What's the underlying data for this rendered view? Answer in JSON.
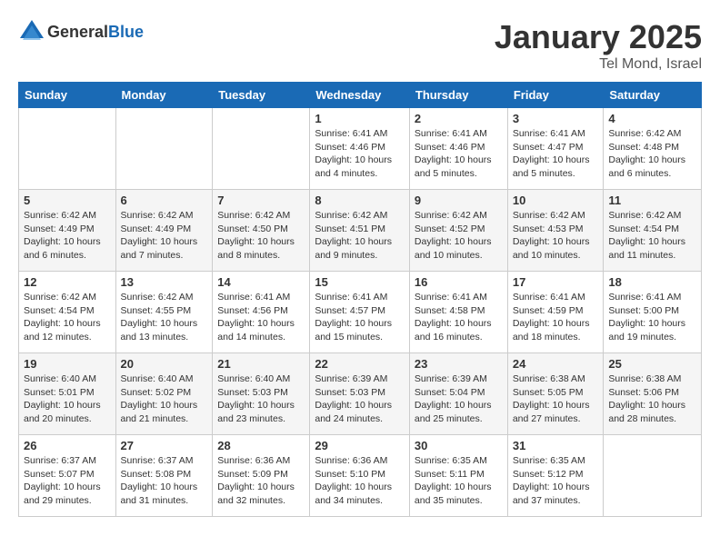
{
  "header": {
    "logo_general": "General",
    "logo_blue": "Blue",
    "month": "January 2025",
    "location": "Tel Mond, Israel"
  },
  "weekdays": [
    "Sunday",
    "Monday",
    "Tuesday",
    "Wednesday",
    "Thursday",
    "Friday",
    "Saturday"
  ],
  "weeks": [
    [
      {
        "day": "",
        "info": ""
      },
      {
        "day": "",
        "info": ""
      },
      {
        "day": "",
        "info": ""
      },
      {
        "day": "1",
        "info": "Sunrise: 6:41 AM\nSunset: 4:46 PM\nDaylight: 10 hours\nand 4 minutes."
      },
      {
        "day": "2",
        "info": "Sunrise: 6:41 AM\nSunset: 4:46 PM\nDaylight: 10 hours\nand 5 minutes."
      },
      {
        "day": "3",
        "info": "Sunrise: 6:41 AM\nSunset: 4:47 PM\nDaylight: 10 hours\nand 5 minutes."
      },
      {
        "day": "4",
        "info": "Sunrise: 6:42 AM\nSunset: 4:48 PM\nDaylight: 10 hours\nand 6 minutes."
      }
    ],
    [
      {
        "day": "5",
        "info": "Sunrise: 6:42 AM\nSunset: 4:49 PM\nDaylight: 10 hours\nand 6 minutes."
      },
      {
        "day": "6",
        "info": "Sunrise: 6:42 AM\nSunset: 4:49 PM\nDaylight: 10 hours\nand 7 minutes."
      },
      {
        "day": "7",
        "info": "Sunrise: 6:42 AM\nSunset: 4:50 PM\nDaylight: 10 hours\nand 8 minutes."
      },
      {
        "day": "8",
        "info": "Sunrise: 6:42 AM\nSunset: 4:51 PM\nDaylight: 10 hours\nand 9 minutes."
      },
      {
        "day": "9",
        "info": "Sunrise: 6:42 AM\nSunset: 4:52 PM\nDaylight: 10 hours\nand 10 minutes."
      },
      {
        "day": "10",
        "info": "Sunrise: 6:42 AM\nSunset: 4:53 PM\nDaylight: 10 hours\nand 10 minutes."
      },
      {
        "day": "11",
        "info": "Sunrise: 6:42 AM\nSunset: 4:54 PM\nDaylight: 10 hours\nand 11 minutes."
      }
    ],
    [
      {
        "day": "12",
        "info": "Sunrise: 6:42 AM\nSunset: 4:54 PM\nDaylight: 10 hours\nand 12 minutes."
      },
      {
        "day": "13",
        "info": "Sunrise: 6:42 AM\nSunset: 4:55 PM\nDaylight: 10 hours\nand 13 minutes."
      },
      {
        "day": "14",
        "info": "Sunrise: 6:41 AM\nSunset: 4:56 PM\nDaylight: 10 hours\nand 14 minutes."
      },
      {
        "day": "15",
        "info": "Sunrise: 6:41 AM\nSunset: 4:57 PM\nDaylight: 10 hours\nand 15 minutes."
      },
      {
        "day": "16",
        "info": "Sunrise: 6:41 AM\nSunset: 4:58 PM\nDaylight: 10 hours\nand 16 minutes."
      },
      {
        "day": "17",
        "info": "Sunrise: 6:41 AM\nSunset: 4:59 PM\nDaylight: 10 hours\nand 18 minutes."
      },
      {
        "day": "18",
        "info": "Sunrise: 6:41 AM\nSunset: 5:00 PM\nDaylight: 10 hours\nand 19 minutes."
      }
    ],
    [
      {
        "day": "19",
        "info": "Sunrise: 6:40 AM\nSunset: 5:01 PM\nDaylight: 10 hours\nand 20 minutes."
      },
      {
        "day": "20",
        "info": "Sunrise: 6:40 AM\nSunset: 5:02 PM\nDaylight: 10 hours\nand 21 minutes."
      },
      {
        "day": "21",
        "info": "Sunrise: 6:40 AM\nSunset: 5:03 PM\nDaylight: 10 hours\nand 23 minutes."
      },
      {
        "day": "22",
        "info": "Sunrise: 6:39 AM\nSunset: 5:03 PM\nDaylight: 10 hours\nand 24 minutes."
      },
      {
        "day": "23",
        "info": "Sunrise: 6:39 AM\nSunset: 5:04 PM\nDaylight: 10 hours\nand 25 minutes."
      },
      {
        "day": "24",
        "info": "Sunrise: 6:38 AM\nSunset: 5:05 PM\nDaylight: 10 hours\nand 27 minutes."
      },
      {
        "day": "25",
        "info": "Sunrise: 6:38 AM\nSunset: 5:06 PM\nDaylight: 10 hours\nand 28 minutes."
      }
    ],
    [
      {
        "day": "26",
        "info": "Sunrise: 6:37 AM\nSunset: 5:07 PM\nDaylight: 10 hours\nand 29 minutes."
      },
      {
        "day": "27",
        "info": "Sunrise: 6:37 AM\nSunset: 5:08 PM\nDaylight: 10 hours\nand 31 minutes."
      },
      {
        "day": "28",
        "info": "Sunrise: 6:36 AM\nSunset: 5:09 PM\nDaylight: 10 hours\nand 32 minutes."
      },
      {
        "day": "29",
        "info": "Sunrise: 6:36 AM\nSunset: 5:10 PM\nDaylight: 10 hours\nand 34 minutes."
      },
      {
        "day": "30",
        "info": "Sunrise: 6:35 AM\nSunset: 5:11 PM\nDaylight: 10 hours\nand 35 minutes."
      },
      {
        "day": "31",
        "info": "Sunrise: 6:35 AM\nSunset: 5:12 PM\nDaylight: 10 hours\nand 37 minutes."
      },
      {
        "day": "",
        "info": ""
      }
    ]
  ]
}
